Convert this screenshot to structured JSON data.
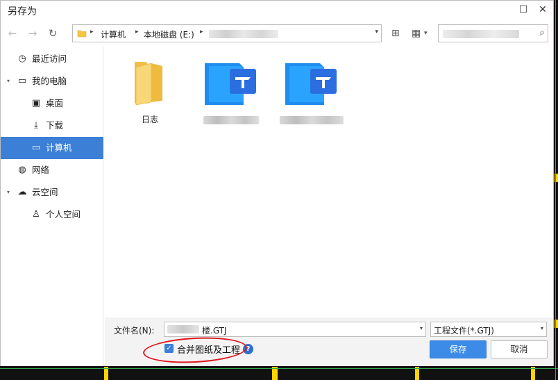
{
  "window": {
    "title": "另存为",
    "maximize_glyph": "☐",
    "close_glyph": "✕"
  },
  "toolbar": {
    "back_icon": "←",
    "forward_icon": "→",
    "refresh_icon": "↻",
    "breadcrumb": [
      "计算机",
      "本地磁盘 (E:)"
    ],
    "breadcrumb_sep": "▸",
    "dropdown_glyph": "▾",
    "new_folder_icon": "⊞",
    "view_icon": "▦",
    "search_icon": "⌕"
  },
  "sidebar": {
    "items": [
      {
        "label": "最近访问",
        "icon": "clock-icon",
        "glyph": "◷",
        "indent": 1,
        "expander": ""
      },
      {
        "label": "我的电脑",
        "icon": "computer-icon",
        "glyph": "▭",
        "indent": 1,
        "expander": "▾"
      },
      {
        "label": "桌面",
        "icon": "desktop-icon",
        "glyph": "▣",
        "indent": 2,
        "expander": ""
      },
      {
        "label": "下载",
        "icon": "download-icon",
        "glyph": "⤓",
        "indent": 2,
        "expander": ""
      },
      {
        "label": "计算机",
        "icon": "monitor-icon",
        "glyph": "▭",
        "indent": 2,
        "expander": "",
        "selected": true
      },
      {
        "label": "网络",
        "icon": "globe-icon",
        "glyph": "◍",
        "indent": 1,
        "expander": ""
      },
      {
        "label": "云空间",
        "icon": "cloud-icon",
        "glyph": "☁",
        "indent": 1,
        "expander": "▾"
      },
      {
        "label": "个人空间",
        "icon": "user-icon",
        "glyph": "♙",
        "indent": 2,
        "expander": ""
      }
    ]
  },
  "files": [
    {
      "type": "folder",
      "icon": "folder-icon",
      "label": "日志"
    },
    {
      "type": "gtj",
      "icon": "gtj-file-icon",
      "label": ""
    },
    {
      "type": "gtj",
      "icon": "gtj-file-icon",
      "label": ""
    }
  ],
  "bottom": {
    "filename_label": "文件名(N):",
    "filename_value": "楼.GTJ",
    "filetype_value": "工程文件(*.GTJ)",
    "dropdown_glyph": "▾",
    "merge_checked": true,
    "check_glyph": "✓",
    "merge_label": "合并图纸及工程",
    "help_glyph": "?",
    "save_label": "保存",
    "cancel_label": "取消"
  },
  "colors": {
    "accent": "#3c7fd6",
    "annotation_oval": "#e0161c"
  }
}
